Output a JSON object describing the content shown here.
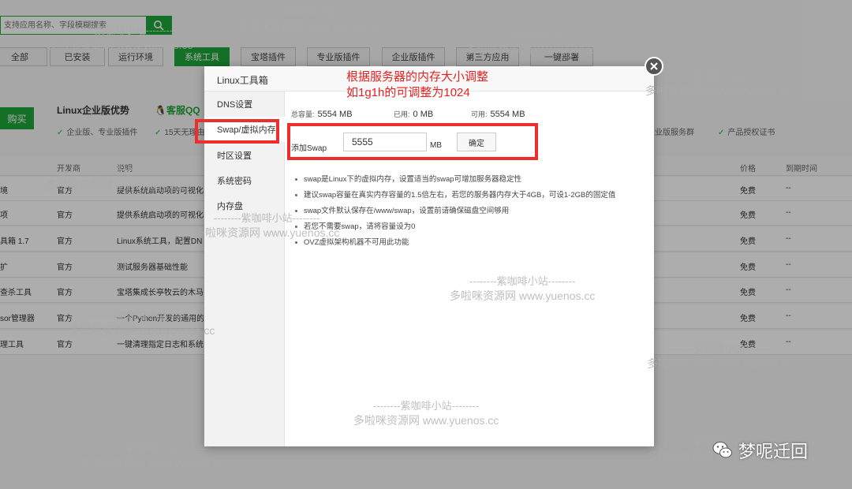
{
  "background": {
    "search": {
      "placeholder": "支持应用名称、字段模糊搜索"
    },
    "tabs": [
      {
        "label": "全部"
      },
      {
        "label": "已安装"
      },
      {
        "label": "运行环境"
      },
      {
        "label": "系统工具",
        "active": true
      },
      {
        "label": "宝塔插件"
      },
      {
        "label": "专业版插件"
      },
      {
        "label": "企业版插件"
      },
      {
        "label": "第三方应用"
      },
      {
        "label": "一键部署"
      }
    ],
    "buy_button": "购买",
    "enterprise_title": "Linux企业版优势",
    "qq_label": "客服QQ",
    "features": [
      "企业版、专业版插件",
      "15天无理由",
      "企业版服务群",
      "产品授权证书"
    ],
    "table": {
      "headers": {
        "developer": "开发商",
        "description": "说明",
        "price": "价格",
        "expiry": "到期时间"
      },
      "rows": [
        {
          "name": "境",
          "developer": "官方",
          "description": "提供系统启动项的可视化",
          "price": "免费",
          "expiry": "--"
        },
        {
          "name": "项",
          "developer": "官方",
          "description": "提供系统启动项的可视化",
          "price": "免费",
          "expiry": "--"
        },
        {
          "name": "具箱 1.7",
          "developer": "官方",
          "description": "Linux系统工具，配置DN",
          "price": "免费",
          "expiry": "--"
        },
        {
          "name": "扩",
          "developer": "官方",
          "description": "测试服务器基础性能",
          "price": "免费",
          "expiry": "--"
        },
        {
          "name": "查杀工具",
          "developer": "官方",
          "description": "宝塔集成长亭牧云的木马",
          "price": "免费",
          "expiry": "--"
        },
        {
          "name": "sor管理器",
          "developer": "官方",
          "description": "一个Python开发的通用的",
          "price": "免费",
          "expiry": "--"
        },
        {
          "name": "理工具",
          "developer": "官方",
          "description": "一键清理指定日志和系统",
          "price": "免费",
          "expiry": "--"
        }
      ]
    }
  },
  "modal": {
    "title": "Linux工具箱",
    "sidebar": [
      {
        "label": "DNS设置"
      },
      {
        "label": "Swap/虚拟内存",
        "active": true
      },
      {
        "label": "时区设置"
      },
      {
        "label": "系统密码"
      },
      {
        "label": "内存盘"
      }
    ],
    "stats": {
      "total_label": "总容量:",
      "total_value": "5554 MB",
      "used_label": "已用:",
      "used_value": "0 MB",
      "free_label": "可用:",
      "free_value": "5554 MB"
    },
    "add_swap": {
      "label": "添加Swap",
      "value": "5555",
      "unit": "MB",
      "confirm": "确定"
    },
    "notes": [
      "swap是Linux下的虚拟内存，设置适当的swap可增加服务器稳定性",
      "建议swap容量在真实内存容量的1.5倍左右，若您的服务器内存大于4GB，可设1-2GB的固定值",
      "swap文件默认保存在/www/swap，设置前请确保磁盘空间够用",
      "若您不需要swap，请将容量设为0",
      "OVZ虚拟架构机器不可用此功能"
    ]
  },
  "annotation": {
    "line1": "根据服务器的内存大小调整",
    "line2": "如1g1h的可调整为1024"
  },
  "watermark": {
    "line1": "--------紫咖啡小站--------",
    "line2": "多啦咪资源网 www.yuenos.cc"
  },
  "badge": {
    "text": "梦呢迁回"
  },
  "colors": {
    "accent": "#20a53a",
    "annotation": "#ee2d2d"
  }
}
